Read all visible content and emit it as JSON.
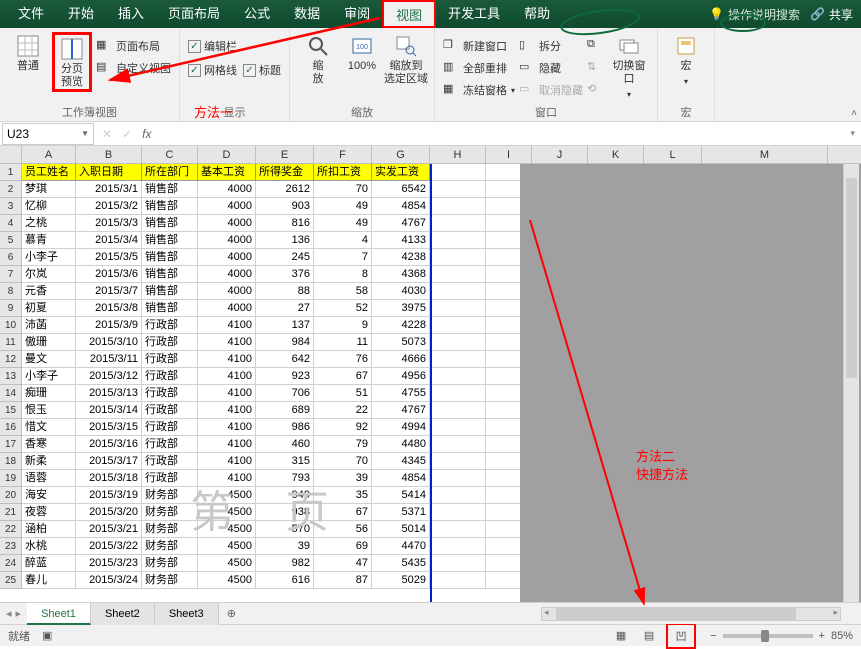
{
  "tabs": {
    "items": [
      "文件",
      "开始",
      "插入",
      "页面布局",
      "公式",
      "数据",
      "审阅",
      "视图",
      "开发工具",
      "帮助"
    ],
    "active_index": 7,
    "search_hint": "操作说明搜索",
    "share": "共享"
  },
  "ribbon": {
    "group1": {
      "normal": "普通",
      "page_break": "分页\n预览",
      "page_layout": "页面布局",
      "custom_view": "自定义视图",
      "label": "工作簿视图"
    },
    "group2": {
      "chk_formulabar": "编辑栏",
      "chk_gridlines": "网格线",
      "chk_headings": "标题",
      "label": "显示"
    },
    "group3": {
      "zoom": "缩\n放",
      "hundred": "100%",
      "zoom_to_sel": "缩放到\n选定区域",
      "label": "缩放"
    },
    "group4": {
      "new_window": "新建窗口",
      "arrange_all": "全部重排",
      "freeze_panes": "冻结窗格",
      "split": "拆分",
      "hide": "隐藏",
      "unhide": "取消隐藏",
      "switch_window": "切换窗口",
      "label": "窗口"
    },
    "group5": {
      "macros": "宏",
      "label": "宏"
    }
  },
  "annotations": {
    "method1": "方法一",
    "method2a": "方法二",
    "method2b": "快捷方法"
  },
  "name_box": "U23",
  "headers": [
    "员工姓名",
    "入职日期",
    "所在部门",
    "基本工资",
    "所得奖金",
    "所扣工资",
    "实发工资"
  ],
  "data_rows": [
    [
      "梦琪",
      "2015/3/1",
      "销售部",
      "4000",
      "2612",
      "70",
      "6542"
    ],
    [
      "忆柳",
      "2015/3/2",
      "销售部",
      "4000",
      "903",
      "49",
      "4854"
    ],
    [
      "之桃",
      "2015/3/3",
      "销售部",
      "4000",
      "816",
      "49",
      "4767"
    ],
    [
      "慕青",
      "2015/3/4",
      "销售部",
      "4000",
      "136",
      "4",
      "4133"
    ],
    [
      "小李子",
      "2015/3/5",
      "销售部",
      "4000",
      "245",
      "7",
      "4238"
    ],
    [
      "尔岚",
      "2015/3/6",
      "销售部",
      "4000",
      "376",
      "8",
      "4368"
    ],
    [
      "元香",
      "2015/3/7",
      "销售部",
      "4000",
      "88",
      "58",
      "4030"
    ],
    [
      "初夏",
      "2015/3/8",
      "销售部",
      "4000",
      "27",
      "52",
      "3975"
    ],
    [
      "沛菡",
      "2015/3/9",
      "行政部",
      "4100",
      "137",
      "9",
      "4228"
    ],
    [
      "傲珊",
      "2015/3/10",
      "行政部",
      "4100",
      "984",
      "11",
      "5073"
    ],
    [
      "曼文",
      "2015/3/11",
      "行政部",
      "4100",
      "642",
      "76",
      "4666"
    ],
    [
      "小李子",
      "2015/3/12",
      "行政部",
      "4100",
      "923",
      "67",
      "4956"
    ],
    [
      "痴珊",
      "2015/3/13",
      "行政部",
      "4100",
      "706",
      "51",
      "4755"
    ],
    [
      "恨玉",
      "2015/3/14",
      "行政部",
      "4100",
      "689",
      "22",
      "4767"
    ],
    [
      "惜文",
      "2015/3/15",
      "行政部",
      "4100",
      "986",
      "92",
      "4994"
    ],
    [
      "香寒",
      "2015/3/16",
      "行政部",
      "4100",
      "460",
      "79",
      "4480"
    ],
    [
      "新柔",
      "2015/3/17",
      "行政部",
      "4100",
      "315",
      "70",
      "4345"
    ],
    [
      "语蓉",
      "2015/3/18",
      "行政部",
      "4100",
      "793",
      "39",
      "4854"
    ],
    [
      "海安",
      "2015/3/19",
      "财务部",
      "4500",
      "949",
      "35",
      "5414"
    ],
    [
      "夜蓉",
      "2015/3/20",
      "财务部",
      "4500",
      "938",
      "67",
      "5371"
    ],
    [
      "涵柏",
      "2015/3/21",
      "财务部",
      "4500",
      "570",
      "56",
      "5014"
    ],
    [
      "水桃",
      "2015/3/22",
      "财务部",
      "4500",
      "39",
      "69",
      "4470"
    ],
    [
      "醉蓝",
      "2015/3/23",
      "财务部",
      "4500",
      "982",
      "47",
      "5435"
    ],
    [
      "春儿",
      "2015/3/24",
      "财务部",
      "4500",
      "616",
      "87",
      "5029"
    ]
  ],
  "watermark_text": "第  页",
  "sheets": {
    "items": [
      "Sheet1",
      "Sheet2",
      "Sheet3"
    ],
    "active_index": 0
  },
  "status": {
    "ready": "就绪",
    "zoom": "85%"
  }
}
